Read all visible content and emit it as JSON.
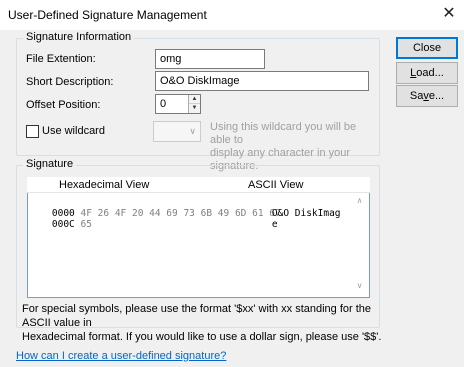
{
  "window": {
    "title": "User-Defined Signature Management",
    "close_glyph": "✕"
  },
  "signature_info": {
    "group_label": "Signature Information",
    "file_extension_label": "File Extention:",
    "file_extension_value": "omg",
    "short_description_label": "Short Description:",
    "short_description_value": "O&O DiskImage",
    "offset_label": "Offset Position:",
    "offset_value": "0",
    "use_wildcard_label": "Use wildcard",
    "use_wildcard_checked": false,
    "wildcard_combo_value": "",
    "wildcard_hint": "Using this wildcard you will be able to display any character in your signature.",
    "wildcard_hint_line1": "Using this wildcard you will be able to",
    "wildcard_hint_line2": "display any character in your signature."
  },
  "signature": {
    "group_label": "Signature",
    "hex_header": "Hexadecimal View",
    "ascii_header": "ASCII View",
    "rows": [
      {
        "offset": "0000",
        "bytes": "4F 26 4F 20 44 69 73 6B 49 6D 61 67",
        "ascii": "O&O DiskImag"
      },
      {
        "offset": "000C",
        "bytes": "65",
        "ascii": "e"
      }
    ],
    "note_line1": "For special symbols, please use the format '$xx' with xx standing for the ASCII value in",
    "note_line2": "Hexadecimal format. If you would like to use a dollar sign, please use '$$'."
  },
  "buttons": {
    "close": "Close",
    "load_prefix": "",
    "load_underline": "L",
    "load_rest": "oad...",
    "save_prefix": "Sa",
    "save_underline": "v",
    "save_rest": "e..."
  },
  "help_link": "How can I create a user-defined signature?",
  "icons": {
    "spin_up": "▲",
    "spin_down": "▼",
    "combo_arrow": "∨",
    "scroll_up": "∧",
    "scroll_down": "∨"
  },
  "colors": {
    "accent": "#0078d7",
    "link": "#0066cc",
    "disabled": "#a0a0a0"
  }
}
